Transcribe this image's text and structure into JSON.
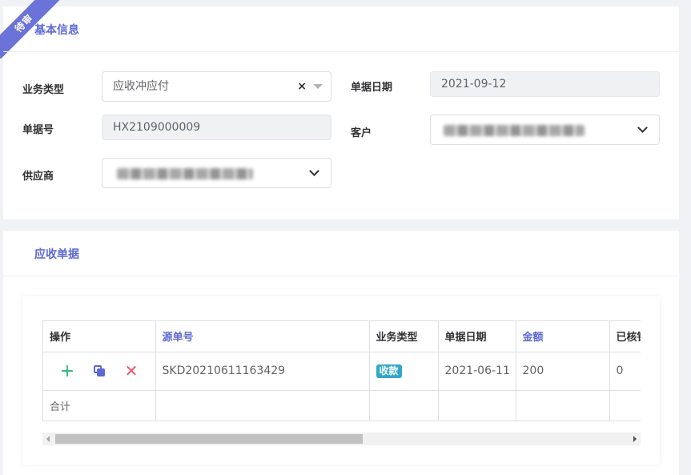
{
  "status_ribbon": "待审",
  "basic": {
    "title": "基本信息",
    "business_type_label": "业务类型",
    "business_type_value": "应收冲应付",
    "clear_symbol": "×",
    "doc_date_label": "单据日期",
    "doc_date_value": "2021-09-12",
    "doc_no_label": "单据号",
    "doc_no_value": "HX2109000009",
    "customer_label": "客户",
    "supplier_label": "供应商"
  },
  "receivables": {
    "title": "应收单据",
    "columns": [
      "操作",
      "源单号",
      "业务类型",
      "单据日期",
      "金额",
      "已核销"
    ],
    "row": {
      "op_add": "+",
      "op_del": "✕",
      "source_no": "SKD20210611163429",
      "biz_type": "收款",
      "date": "2021-06-11",
      "amount": "200",
      "verified": "0"
    },
    "summary_label": "合计"
  },
  "colors": {
    "accent": "#5b68d6",
    "ribbon": "#6b73d8",
    "add": "#2bb57a",
    "delete": "#f0506e",
    "badge": "#2fa7c9"
  },
  "icons": [
    "clear-icon",
    "caret-down-icon",
    "chevron-down-icon",
    "add-icon",
    "copy-icon",
    "delete-icon"
  ]
}
